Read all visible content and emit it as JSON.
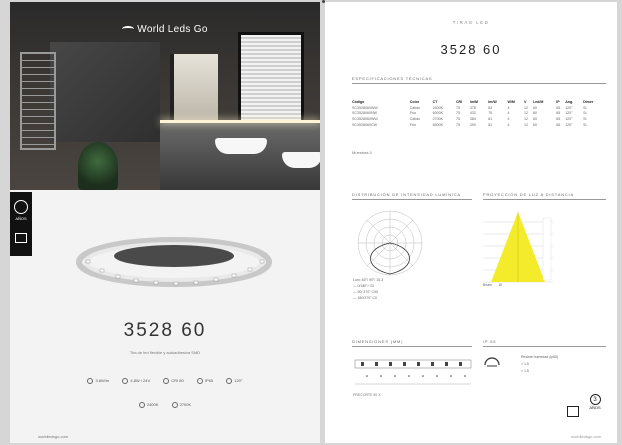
{
  "left_page": {
    "brand": "World Leds Go",
    "product_title": "3528 60",
    "subtitle": "Tira de led flexible y autoadhesiva SMD",
    "specs_row1": [
      "3.8W/m",
      "4,8W / 24V",
      "CRI 80",
      "IP65",
      "120°"
    ],
    "specs_row2": [
      "2400K",
      "2700K"
    ],
    "side_badge_text": "AÑOS",
    "footer_left": "worldledsgo.com",
    "footer_right": ""
  },
  "right_page": {
    "category": "TIRAS LED",
    "title": "3528 60",
    "sections": {
      "specs": "ESPECIFICACIONES TÉCNICAS",
      "distribution": "DISTRIBUCIÓN DE INTENSIDAD LUMÍNICA",
      "projection": "PROYECCIÓN DE LUZ A DISTANCIA",
      "dimensions": "DIMENSIONES (MM)",
      "ip": "IP 65"
    },
    "table": {
      "headers": [
        "Código",
        "Color",
        "CT",
        "CRI",
        "lm/M",
        "lm/W",
        "W/M",
        "V",
        "Led/M",
        "IP",
        "Ang.",
        "Dimer"
      ],
      "rows": [
        [
          "SC3528060WW",
          "Cálido",
          "2400K",
          "75",
          "378",
          "83",
          "4",
          "12",
          "60",
          "65",
          "120°",
          "Sí"
        ],
        [
          "SC3528060NW",
          "Frío",
          "6000K",
          "75",
          "432",
          "75",
          "4",
          "12",
          "60",
          "65",
          "120°",
          "Sí"
        ],
        [
          "SC3528060WW",
          "Cálido",
          "2700K",
          "75",
          "384",
          "81",
          "4",
          "12",
          "60",
          "65",
          "120°",
          "Sí"
        ],
        [
          "SC3528060CW",
          "Frío",
          "6500K",
          "75",
          "390",
          "81",
          "4",
          "12",
          "60",
          "65",
          "120°",
          "Sí"
        ]
      ]
    },
    "muestras": "Muestras 5",
    "polar_legend": [
      "Lum: 60°/ 90°/ 15.3",
      "— 0/180°/ C0",
      "— 90/ 270° C90",
      "— 180/270° C0"
    ],
    "lux_foot": [
      "Beam",
      "Ø"
    ],
    "dims_foot": "PRECORTE 50 X",
    "ip_notes": [
      "Resiste humedad (ip65)",
      "> 1.5",
      "> 1.5"
    ],
    "badge_years": "3",
    "badge_label": "AÑOS",
    "footer": "worldledsgo.com"
  }
}
